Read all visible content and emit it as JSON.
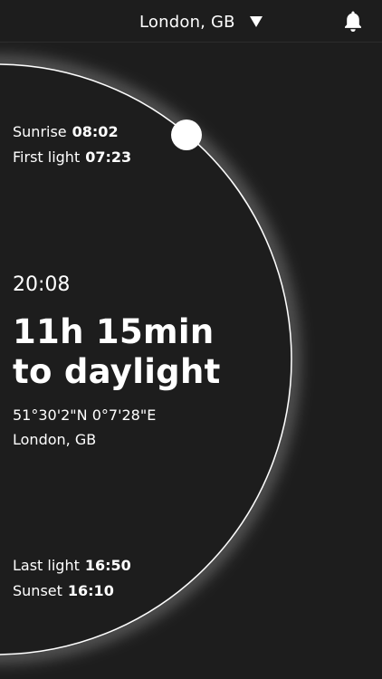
{
  "header": {
    "location": "London, GB",
    "dropdown_icon": "triangle-down-icon",
    "notifications_icon": "bell-icon"
  },
  "sun_times": {
    "sunrise": {
      "label": "Sunrise",
      "value": "08:02"
    },
    "first_light": {
      "label": "First light",
      "value": "07:23"
    },
    "last_light": {
      "label": "Last light",
      "value": "16:50"
    },
    "sunset": {
      "label": "Sunset",
      "value": "16:10"
    }
  },
  "main": {
    "current_time": "20:08",
    "countdown_line1": "11h 15min",
    "countdown_line2": "to daylight",
    "coordinates": "51°30'2\"N  0°7'28\"E",
    "place": "London, GB"
  },
  "colors": {
    "background": "#1d1d1d",
    "text": "#ffffff",
    "orbit": "#ffffff"
  }
}
